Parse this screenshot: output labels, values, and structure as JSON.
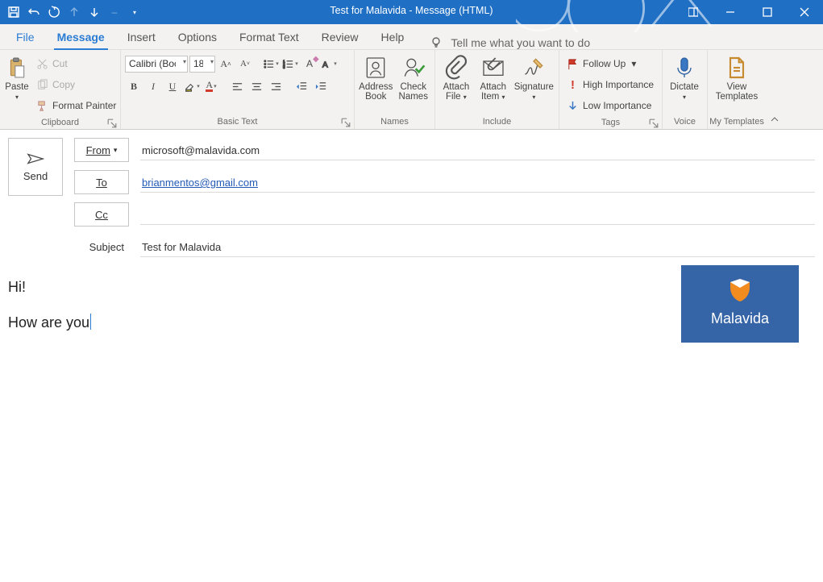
{
  "window": {
    "title": "Test for Malavida  -  Message (HTML)",
    "qat": {
      "save": "save-icon",
      "undo": "undo-icon",
      "redo": "redo-icon",
      "up": "arrow-up-icon",
      "down": "arrow-down-icon",
      "custom": "▾",
      "sep": "–"
    },
    "controls": {
      "snap": "snap",
      "min": "min",
      "max": "max",
      "close": "close"
    }
  },
  "tabs": {
    "file": "File",
    "message": "Message",
    "insert": "Insert",
    "options": "Options",
    "format": "Format Text",
    "review": "Review",
    "help": "Help",
    "tell": "Tell me what you want to do"
  },
  "ribbon": {
    "clipboard": {
      "label": "Clipboard",
      "paste": "Paste",
      "cut": "Cut",
      "copy": "Copy",
      "painter": "Format Painter"
    },
    "basic": {
      "label": "Basic Text",
      "font": "Calibri (Boc",
      "size": "18",
      "bold": "B",
      "italic": "I",
      "underline": "U"
    },
    "names": {
      "label": "Names",
      "addr1": "Address",
      "addr2": "Book",
      "check1": "Check",
      "check2": "Names"
    },
    "include": {
      "label": "Include",
      "af1": "Attach",
      "af2": "File",
      "ai1": "Attach",
      "ai2": "Item",
      "sig": "Signature"
    },
    "tags": {
      "label": "Tags",
      "follow": "Follow Up",
      "high": "High Importance",
      "low": "Low Importance"
    },
    "voice": {
      "label": "Voice",
      "dictate": "Dictate"
    },
    "templates": {
      "label": "My Templates",
      "view1": "View",
      "view2": "Templates"
    }
  },
  "compose": {
    "send": "Send",
    "from_lbl": "From",
    "to_lbl": "To",
    "cc_lbl": "Cc",
    "subject_lbl": "Subject",
    "from": "microsoft@malavida.com",
    "to": "brianmentos@gmail.com",
    "cc": "",
    "subject": "Test for Malavida",
    "logo_text": "Malavida"
  },
  "body": {
    "line1": "Hi!",
    "line2": "How are you"
  }
}
